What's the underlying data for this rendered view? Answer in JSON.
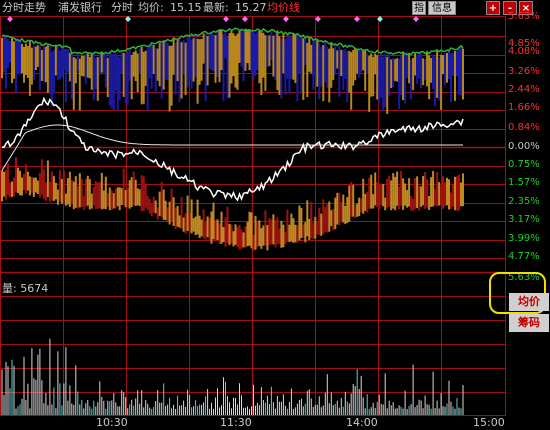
{
  "header": {
    "view_title": "分时走势",
    "stock_name": "浦发银行",
    "view_type": "分时",
    "avg_label": "均价:",
    "avg_value": "15.15",
    "last_label": "最新:",
    "last_value": "15.27",
    "avg_line_label": "均价线",
    "btn_indicator": "指",
    "btn_info": "信息",
    "btn_plus": "+",
    "btn_minus": "-",
    "btn_close": "×"
  },
  "right_axis": {
    "upper": [
      "5.63%",
      "4.85%",
      "4.08%",
      "3.26%",
      "2.44%",
      "1.66%",
      "0.84%",
      "0.00%",
      "0.75%",
      "1.57%",
      "2.35%",
      "3.17%",
      "3.99%",
      "4.77%",
      "5.63%"
    ]
  },
  "volume": {
    "label": "量:",
    "value": "5674"
  },
  "time_axis": [
    "10:30",
    "11:30",
    "14:00",
    "15:00"
  ],
  "side_buttons": {
    "avg": "均价",
    "chips": "筹码"
  },
  "colors": {
    "background": "#000000",
    "grid": "#a01010",
    "price_line": "#ffffff",
    "avg_line": "#e8e8e8",
    "up_blue": "#1a1aa8",
    "up_gold": "#b8861a",
    "down_red": "#a01010",
    "down_gold": "#c08a20",
    "pos_text": "#ff3030",
    "neg_text": "#20d020",
    "volume_bar": "#d8d8d8",
    "highlight": "#f0e000"
  }
}
